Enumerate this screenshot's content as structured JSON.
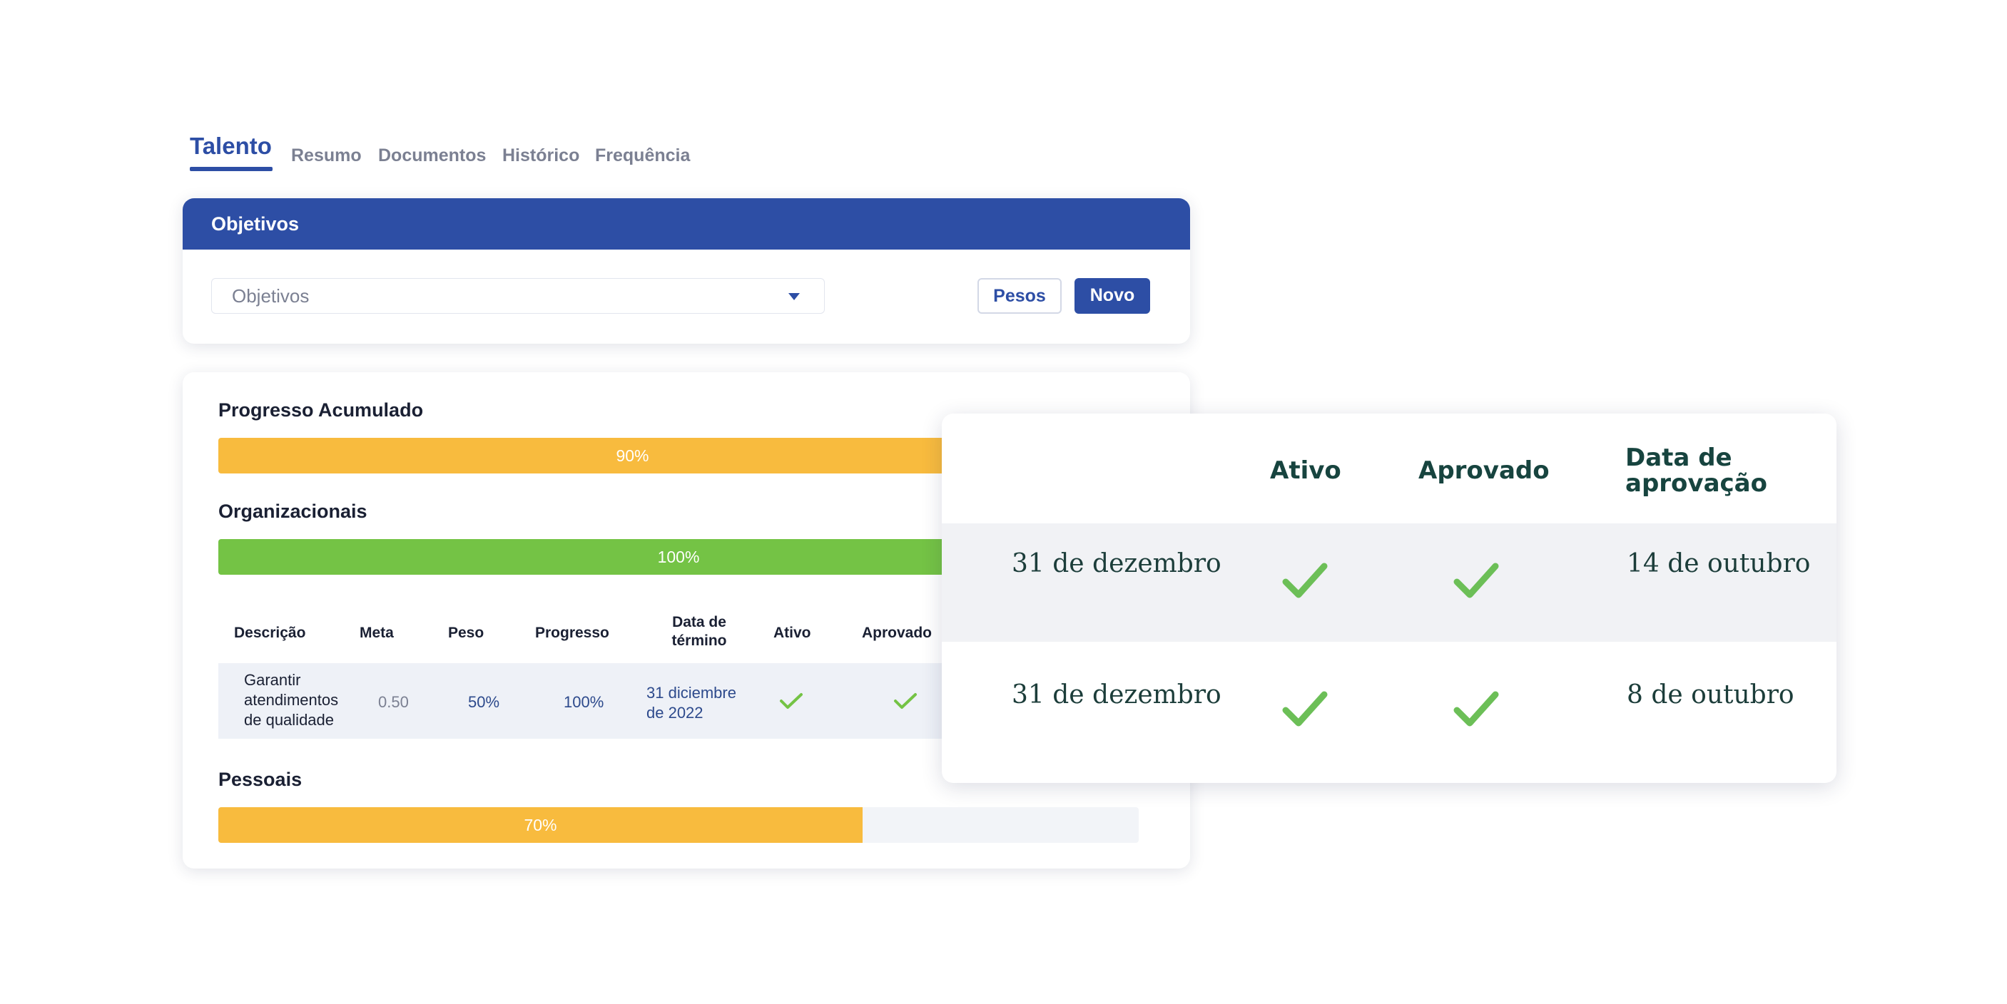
{
  "tabs": [
    {
      "label": "Talento",
      "active": true
    },
    {
      "label": "Resumo",
      "active": false
    },
    {
      "label": "Documentos",
      "active": false
    },
    {
      "label": "Histórico",
      "active": false
    },
    {
      "label": "Frequência",
      "active": false
    }
  ],
  "objetivos_card": {
    "header": "Objetivos",
    "select_value": "Objetivos",
    "pesos_label": "Pesos",
    "novo_label": "Novo"
  },
  "progress_card": {
    "acumulado": {
      "title": "Progresso Acumulado",
      "label": "90%",
      "value": 0.9
    },
    "organizacionais": {
      "title": "Organizacionais",
      "label": "100%",
      "value": 1.0
    },
    "pessoais": {
      "title": "Pessoais",
      "label": "70%",
      "value": 0.7
    },
    "table": {
      "headers": {
        "descricao": "Descrição",
        "meta": "Meta",
        "peso": "Peso",
        "progresso": "Progresso",
        "data_termino_1": "Data de",
        "data_termino_2": "término",
        "ativo": "Ativo",
        "aprovado": "Aprovado"
      },
      "row": {
        "desc_1": "Garantir",
        "desc_2": "atendimentos",
        "desc_3": "de qualidade",
        "meta": "0.50",
        "peso": "50%",
        "progresso": "100%",
        "data_1": "31 diciembre",
        "data_2": "de 2022",
        "ativo": true,
        "aprovado": true
      }
    }
  },
  "overlay_table": {
    "headers": {
      "ativo": "Ativo",
      "aprovado": "Aprovado",
      "data_aprovacao_1": "Data de",
      "data_aprovacao_2": "aprovação"
    },
    "rows": [
      {
        "date": "31 de dezembro",
        "ativo": true,
        "aprovado": true,
        "data_aprovacao": "14 de outubro"
      },
      {
        "date": "31 de dezembro",
        "ativo": true,
        "aprovado": true,
        "data_aprovacao": "8 de outubro"
      }
    ]
  },
  "colors": {
    "primary": "#2d4ea5",
    "yellow": "#f8bb3e",
    "green": "#74c345",
    "check": "#6cbf57",
    "overlay_text": "#17443f"
  }
}
